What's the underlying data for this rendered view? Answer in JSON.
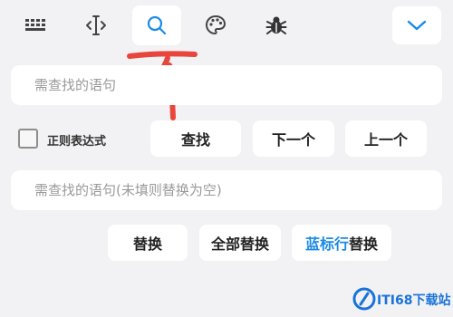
{
  "toolbar": {
    "icons": [
      "keyboard-icon",
      "text-cursor-icon",
      "search-icon",
      "palette-icon",
      "bug-icon",
      "chevron-down-icon"
    ],
    "active_tab": "search"
  },
  "search": {
    "placeholder": "需查找的语句",
    "value": ""
  },
  "regex": {
    "label": "正则表达式",
    "checked": false
  },
  "find_buttons": {
    "find_label": "查找",
    "next_label": "下一个",
    "prev_label": "上一个"
  },
  "replace": {
    "placeholder": "需查找的语句(未填则替换为空)",
    "value": ""
  },
  "replace_buttons": {
    "replace_label": "替换",
    "replace_all_label": "全部替换",
    "replace_line_highlight": "蓝标行",
    "replace_line_rest": "替换"
  },
  "watermark": {
    "brand": "ITI68下载站"
  },
  "colors": {
    "accent": "#1a8ae6",
    "annotation": "#e8463c",
    "background": "#f2f2f4"
  }
}
